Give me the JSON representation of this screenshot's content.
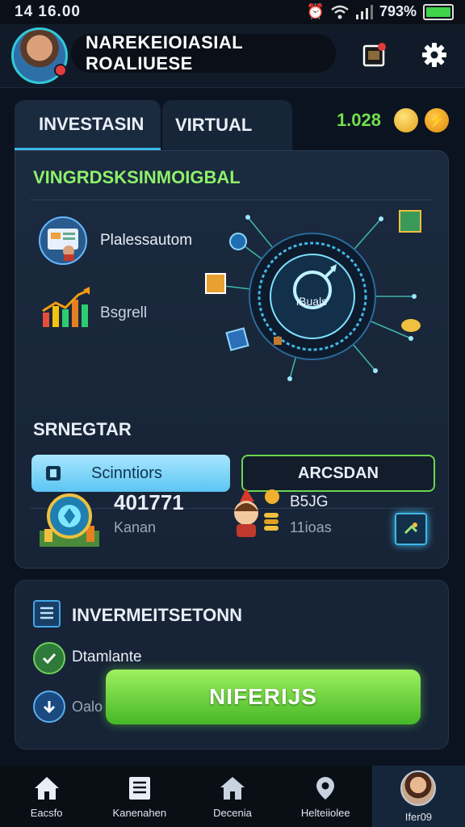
{
  "status_bar": {
    "time": "14 16.00",
    "battery": "793%"
  },
  "header": {
    "title": "NAREKEIOIASIAL ROALIUESE"
  },
  "tabs": [
    {
      "label": "INVESTASIN"
    },
    {
      "label": "VIRTUAL"
    }
  ],
  "currency": {
    "value": "1.028"
  },
  "panel": {
    "title": "VINGRDSKSINMOIGBAL",
    "item1_label": "Plalessautom",
    "item2_label": "Bsgrell",
    "hub_label": "iBuals",
    "section2_title": "SRNEGTAR",
    "button_primary": "Scinntiors",
    "button_secondary": "ARCSDAN",
    "stat1_value": "401771",
    "stat1_label": "Kanan",
    "stat2_value": "B5JG",
    "stat2_label": "11ioas"
  },
  "lower": {
    "title": "INVERMEITSETONN",
    "row1_label": "Dtamlante",
    "row2_label": "Oalo",
    "cta_label": "NIFERIJS"
  },
  "nav": [
    {
      "label": "Eacsfo",
      "icon": "home-icon"
    },
    {
      "label": "Kanenahen",
      "icon": "document-icon"
    },
    {
      "label": "Decenia",
      "icon": "house-icon"
    },
    {
      "label": "Helteiiolee",
      "icon": "location-pin-icon"
    },
    {
      "label": "Ifer09",
      "icon": "profile-avatar"
    }
  ],
  "colors": {
    "accent_green": "#6fe04c",
    "accent_blue": "#3bb8e8",
    "background": "#0c1320"
  }
}
